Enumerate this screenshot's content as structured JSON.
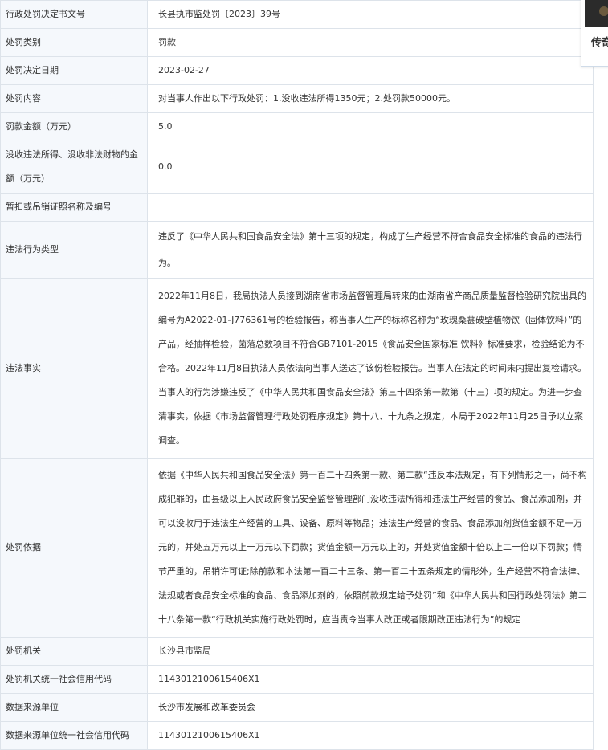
{
  "rows": [
    {
      "label": "行政处罚决定书文号",
      "value": "长县执市监处罚〔2023〕39号"
    },
    {
      "label": "处罚类别",
      "value": "罚款"
    },
    {
      "label": "处罚决定日期",
      "value": "2023-02-27"
    },
    {
      "label": "处罚内容",
      "value": "对当事人作出以下行政处罚：1.没收违法所得1350元；2.处罚款50000元。"
    },
    {
      "label": "罚款金额（万元）",
      "value": "5.0"
    },
    {
      "label": "没收违法所得、没收非法财物的金额（万元）",
      "value": "0.0"
    },
    {
      "label": "暂扣或吊销证照名称及编号",
      "value": ""
    },
    {
      "label": "违法行为类型",
      "value": "违反了《中华人民共和国食品安全法》第十三项的规定，构成了生产经营不符合食品安全标准的食品的违法行为。"
    },
    {
      "label": "违法事实",
      "value": "2022年11月8日，我局执法人员接到湖南省市场监督管理局转来的由湖南省产商品质量监督检验研究院出具的编号为A2022-01-J776361号的检验报告，称当事人生产的标称名称为“玫瑰桑葚破壁植物饮（固体饮料）”的产品，经抽样检验，菌落总数项目不符合GB7101-2015《食品安全国家标准 饮料》标准要求，检验结论为不合格。2022年11月8日执法人员依法向当事人送达了该份检验报告。当事人在法定的时间未内提出复检请求。当事人的行为涉嫌违反了《中华人民共和国食品安全法》第三十四条第一款第（十三）项的规定。为进一步查清事实，依据《市场监督管理行政处罚程序规定》第十八、十九条之规定，本局于2022年11月25日予以立案调查。"
    },
    {
      "label": "处罚依据",
      "value": "依据《中华人民共和国食品安全法》第一百二十四条第一款、第二款“违反本法规定，有下列情形之一，尚不构成犯罪的，由县级以上人民政府食品安全监督管理部门没收违法所得和违法生产经营的食品、食品添加剂，并可以没收用于违法生产经营的工具、设备、原料等物品；违法生产经营的食品、食品添加剂货值金额不足一万元的，并处五万元以上十万元以下罚款；货值金额一万元以上的，并处货值金额十倍以上二十倍以下罚款；情节严重的，吊销许可证;除前款和本法第一百二十三条、第一百二十五条规定的情形外，生产经营不符合法律、法规或者食品安全标准的食品、食品添加剂的，依照前款规定给予处罚”和《中华人民共和国行政处罚法》第二十八条第一款“行政机关实施行政处罚时，应当责令当事人改正或者限期改正违法行为”的规定"
    },
    {
      "label": "处罚机关",
      "value": "长沙县市监局"
    },
    {
      "label": "处罚机关统一社会信用代码",
      "value": "1143012100615406X1"
    },
    {
      "label": "数据来源单位",
      "value": "长沙市发展和改革委员会"
    },
    {
      "label": "数据来源单位统一社会信用代码",
      "value": "1143012100615406X1"
    }
  ],
  "side_card": {
    "text": "传奇"
  }
}
